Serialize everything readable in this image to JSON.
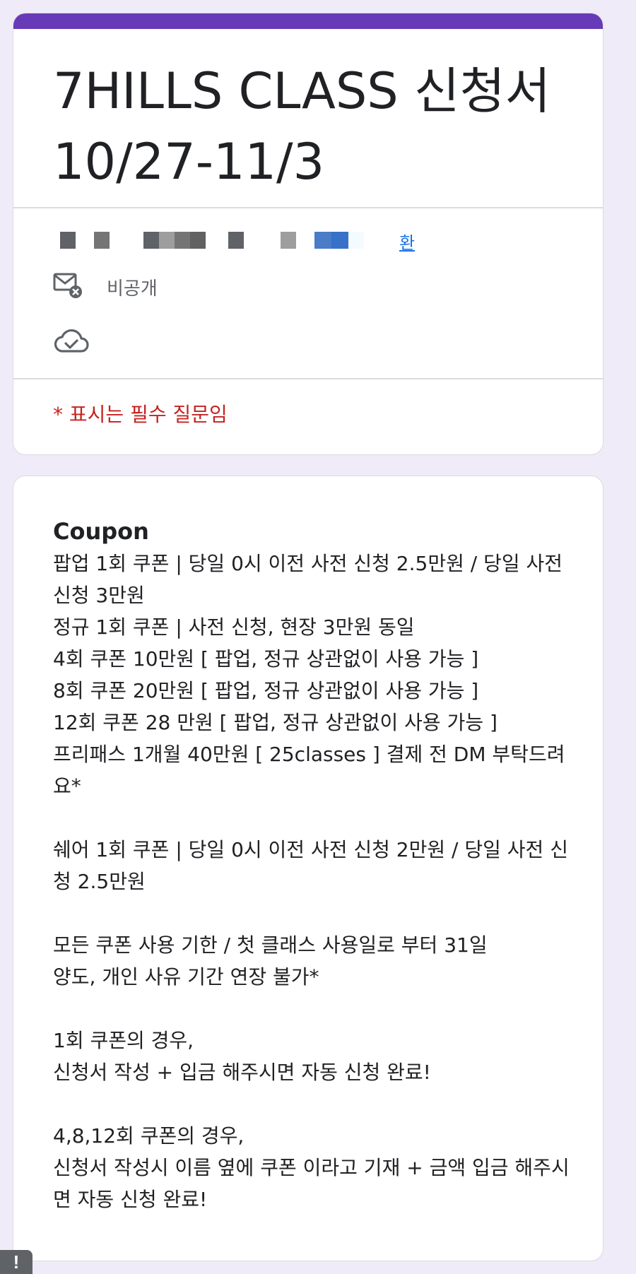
{
  "form": {
    "title": "7HILLS CLASS 신청서 10/27-11/3",
    "accent_color": "#673ab7",
    "account": {
      "switch_label": "환",
      "link_color": "#1a73e8"
    },
    "private_label": "비공개",
    "required_note": "* 표시는 필수 질문임",
    "required_color": "#c5221f"
  },
  "description": {
    "heading": "Coupon",
    "blocks": [
      [
        "팝업 1회 쿠폰 | 당일 0시 이전 사전 신청 2.5만원 / 당일 사전 신청 3만원",
        "정규 1회 쿠폰 | 사전 신청, 현장 3만원 동일",
        "4회 쿠폰 10만원 [ 팝업, 정규 상관없이 사용 가능 ]",
        "8회 쿠폰 20만원 [ 팝업, 정규 상관없이 사용 가능 ]",
        "12회 쿠폰 28 만원 [ 팝업, 정규 상관없이 사용 가능 ]",
        "프리패스 1개월 40만원 [ 25classes ] 결제 전 DM 부탁드려요*"
      ],
      [
        "쉐어 1회 쿠폰 | 당일 0시 이전 사전 신청 2만원 / 당일 사전 신청 2.5만원"
      ],
      [
        "모든 쿠폰 사용 기한 / 첫 클래스 사용일로 부터 31일",
        "양도, 개인 사유 기간 연장 불가*"
      ],
      [
        "1회 쿠폰의 경우,",
        "신청서 작성 + 입금 해주시면 자동 신청 완료!"
      ],
      [
        "4,8,12회 쿠폰의 경우,",
        "신청서 작성시 이름 옆에 쿠폰 이라고 기재 + 금액 입금 해주시면 자동 신청 완료!"
      ]
    ]
  },
  "footer": {
    "report_label": "!"
  }
}
